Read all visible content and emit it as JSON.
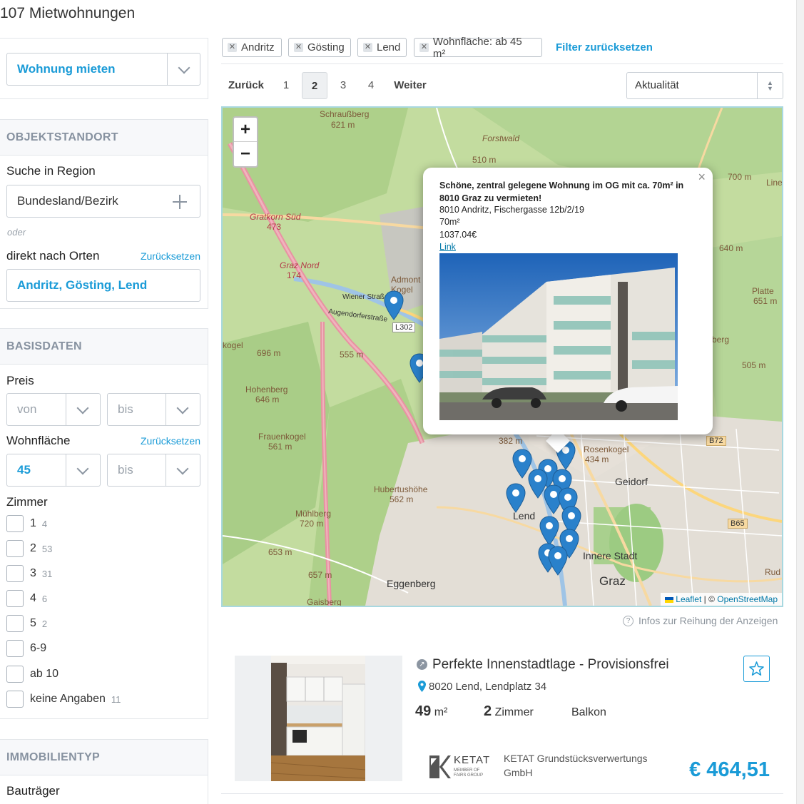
{
  "page_title": "107 Mietwohnungen",
  "sidebar": {
    "category_select": "Wohnung mieten",
    "location": {
      "heading": "OBJEKTSTANDORT",
      "region_label": "Suche in Region",
      "region_value": "Bundesland/Bezirk",
      "or_text": "oder",
      "places_label": "direkt nach Orten",
      "places_reset": "Zurücksetzen",
      "places_value": "Andritz, Gösting, Lend"
    },
    "basics": {
      "heading": "BASISDATEN",
      "price_label": "Preis",
      "price_from": "von",
      "price_to": "bis",
      "area_label": "Wohnfläche",
      "area_reset": "Zurücksetzen",
      "area_from": "45",
      "area_to": "bis",
      "rooms_label": "Zimmer",
      "rooms": [
        {
          "label": "1",
          "count": "4"
        },
        {
          "label": "2",
          "count": "53"
        },
        {
          "label": "3",
          "count": "31"
        },
        {
          "label": "4",
          "count": "6"
        },
        {
          "label": "5",
          "count": "2"
        },
        {
          "label": "6-9",
          "count": ""
        },
        {
          "label": "ab 10",
          "count": ""
        },
        {
          "label": "keine Angaben",
          "count": "11"
        }
      ]
    },
    "property_type": {
      "heading": "IMMOBILIENTYP",
      "developer_label": "Bauträger"
    }
  },
  "filters": {
    "chips": [
      "Andritz",
      "Gösting",
      "Lend",
      "Wohnfläche: ab 45 m²"
    ],
    "reset": "Filter zurücksetzen"
  },
  "pagination": {
    "prev": "Zurück",
    "pages": [
      "1",
      "2",
      "3",
      "4"
    ],
    "current": "2",
    "next": "Weiter"
  },
  "sort": {
    "value": "Aktualität"
  },
  "map": {
    "zoom_in": "+",
    "zoom_out": "−",
    "labels": [
      "Schraußberg",
      "621 m",
      "Forstwald",
      "510 m",
      "Gratkorn Süd",
      "473",
      "Graz Nord",
      "174",
      "Admont",
      "Kogel",
      "Wiener Straße",
      "Augendorferstraße",
      "L302",
      "696 m",
      "555 m",
      "Hohenberg",
      "646 m",
      "Frauenkogel",
      "561 m",
      "Hubertushöhe",
      "562 m",
      "Mühlberg",
      "720 m",
      "653 m",
      "657 m",
      "Gaisberg",
      "Eggenberg",
      "Lend",
      "Geidorf",
      "Innere Stadt",
      "Graz",
      "382 m",
      "Rosenkogel",
      "434 m",
      "B72",
      "B65",
      "700 m",
      "640 m",
      "Platte",
      "651 m",
      "505 m",
      "Rud",
      "kogel",
      "berg",
      "Line"
    ],
    "attribution_leaflet": "Leaflet",
    "attribution_sep": "| ©",
    "attribution_osm": "OpenStreetMap",
    "popup": {
      "title": "Schöne, zentral gelegene Wohnung im OG mit ca. 70m² in 8010 Graz zu vermieten!",
      "address": "8010 Andritz, Fischergasse 12b/2/19",
      "area": "70m²",
      "price": "1037.04€",
      "link": "Link",
      "close": "×"
    }
  },
  "ranking_info": "Infos zur Reihung der Anzeigen",
  "listing": {
    "title": "Perfekte Innenstadtlage - Provisionsfrei",
    "address": "8020 Lend, Lendplatz 34",
    "area_value": "49",
    "area_unit": "m²",
    "rooms_value": "2",
    "rooms_unit": "Zimmer",
    "feature": "Balkon",
    "agency": "KETAT Grundstücksverwertungs GmbH",
    "agency_logo_text": "KETAT",
    "agency_logo_sub": "MEMBER OF FAIRS GROUP",
    "price": "€ 464,51"
  },
  "colors": {
    "accent": "#1a9bd7",
    "marker": "#2a81cb"
  }
}
